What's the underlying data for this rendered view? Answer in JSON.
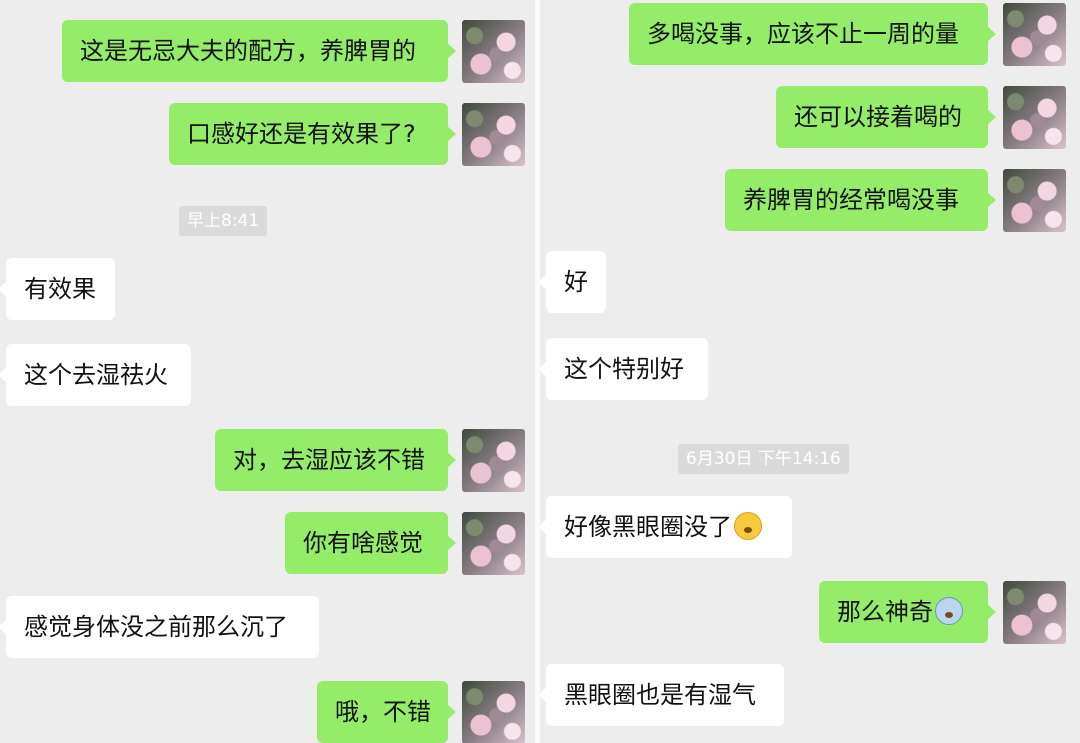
{
  "left": {
    "messages": [
      {
        "text": "这是无忌大夫的配方，养脾胃的"
      },
      {
        "text": "口感好还是有效果了?"
      },
      {
        "text": "有效果"
      },
      {
        "text": "这个去湿祛火"
      },
      {
        "text": "对，去湿应该不错"
      },
      {
        "text": "你有啥感觉"
      },
      {
        "text": "感觉身体没之前那么沉了"
      },
      {
        "text": "哦，不错"
      }
    ],
    "timestamp": "早上8:41"
  },
  "right": {
    "messages": [
      {
        "text": "多喝没事，应该不止一周的量"
      },
      {
        "text": "还可以接着喝的"
      },
      {
        "text": "养脾胃的经常喝没事"
      },
      {
        "text": "好"
      },
      {
        "text": "这个特别好"
      },
      {
        "text": "好像黑眼圈没了"
      },
      {
        "text": "那么神奇"
      },
      {
        "text": "黑眼圈也是有湿气"
      }
    ],
    "timestamp": "6月30日 下午14:16",
    "emoji": [
      "thinking-face",
      "screaming-face"
    ]
  },
  "colors": {
    "background": "#ededed",
    "outgoing_bubble": "#95ec69",
    "incoming_bubble": "#ffffff",
    "timestamp_bg": "#dadada"
  }
}
